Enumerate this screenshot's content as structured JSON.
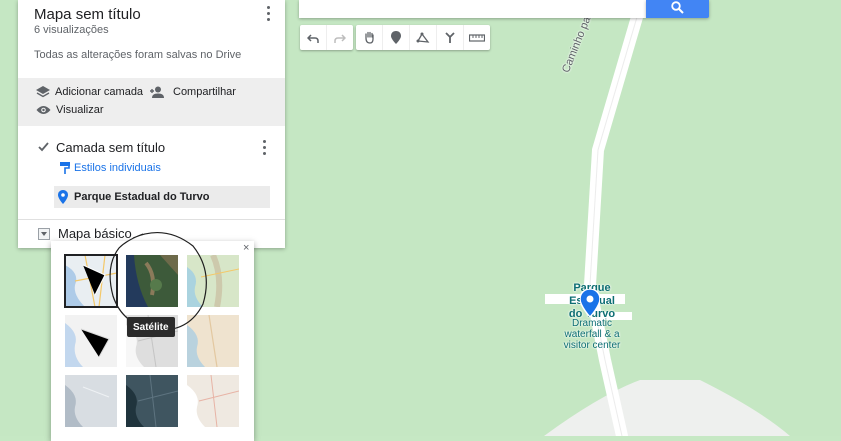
{
  "panel": {
    "title": "Mapa sem título",
    "views": "6 visualizações",
    "save_status": "Todas as alterações foram salvas no Drive",
    "actions": {
      "add_layer": "Adicionar camada",
      "share": "Compartilhar",
      "preview": "Visualizar"
    },
    "layer": {
      "name": "Camada sem título",
      "checked": true,
      "styles_link": "Estilos individuais",
      "feature": "Parque Estadual do Turvo"
    },
    "basemap": {
      "label": "Mapa básico"
    }
  },
  "basemap_popup": {
    "close": "×",
    "tooltip": "Satélite",
    "thumbnails": [
      "map",
      "satellite",
      "terrain",
      "light-political",
      "mono-city",
      "simple-atlas",
      "light-landmass",
      "dark-landmass",
      "whitewater"
    ],
    "selected": "map"
  },
  "map": {
    "road_label": "Caminho para Salto do Yucumã",
    "place_name_lines": [
      "Parque",
      "Estadual",
      "do Turvo"
    ],
    "place_desc": "Dramatic waterfall & a visitor center",
    "colors": {
      "land": "#c5e7c3",
      "road": "#ffffff",
      "pin": "#1a73e8",
      "search": "#4285f4"
    }
  },
  "toolbar": {
    "tools": [
      "undo-icon",
      "redo-icon",
      "hand-icon",
      "marker-icon",
      "line-icon",
      "directions-icon",
      "ruler-icon"
    ]
  }
}
